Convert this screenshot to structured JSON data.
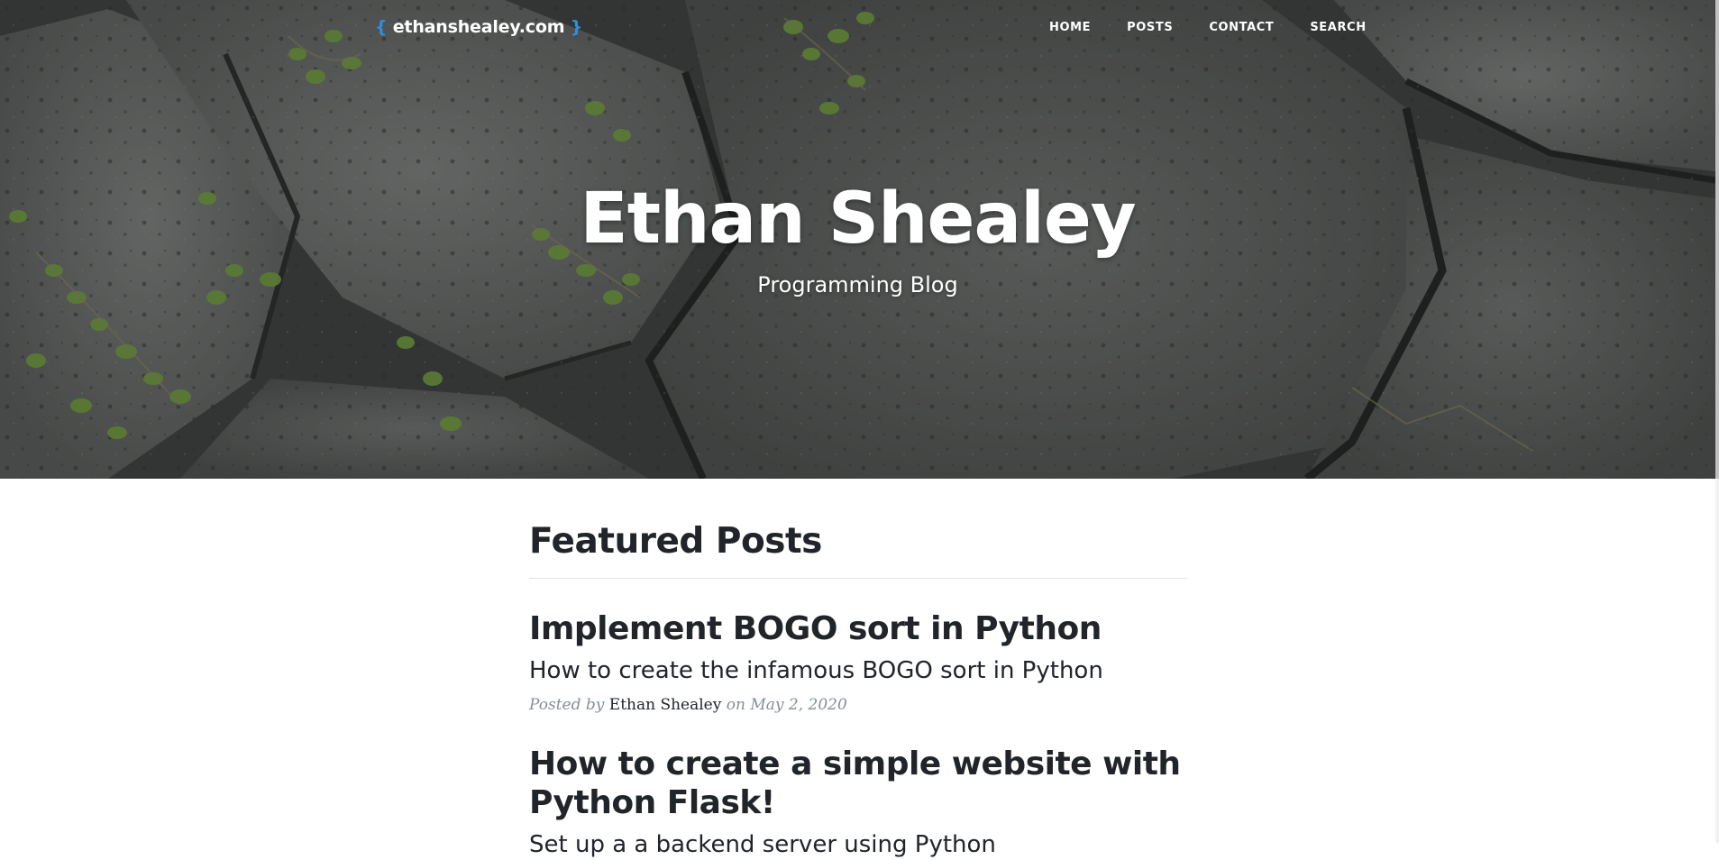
{
  "navbar": {
    "brand_open": "{",
    "brand_text": "ethanshealey.com",
    "brand_close": "}",
    "links": [
      {
        "label": "HOME"
      },
      {
        "label": "POSTS"
      },
      {
        "label": "CONTACT"
      },
      {
        "label": "SEARCH"
      }
    ]
  },
  "hero": {
    "title": "Ethan Shealey",
    "subtitle": "Programming Blog"
  },
  "featured": {
    "heading": "Featured Posts",
    "posts": [
      {
        "title": "Implement BOGO sort in Python",
        "subtitle": "How to create the infamous BOGO sort in Python",
        "meta_prefix": "Posted by",
        "author": "Ethan Shealey",
        "meta_on": "on",
        "date": "May 2, 2020"
      },
      {
        "title": "How to create a simple website with Python Flask!",
        "subtitle": "Set up a a backend server using Python"
      }
    ]
  },
  "colors": {
    "brand_brace": "#2f8fdd",
    "heading_text": "#212529",
    "meta_text": "#868e96",
    "hero_overlay": "#4b4d4c"
  }
}
